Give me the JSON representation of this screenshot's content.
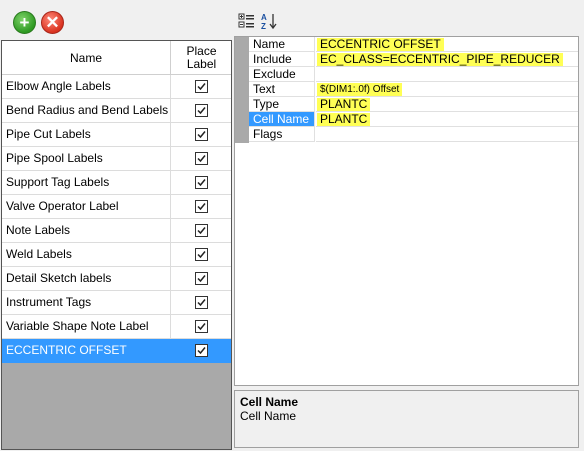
{
  "list": {
    "header_name": "Name",
    "header_place": "Place Label",
    "items": [
      {
        "name": "Elbow Angle Labels",
        "checked": true
      },
      {
        "name": "Bend Radius and Bend Labels",
        "checked": true
      },
      {
        "name": "Pipe Cut Labels",
        "checked": true
      },
      {
        "name": "Pipe Spool Labels",
        "checked": true
      },
      {
        "name": "Support Tag Labels",
        "checked": true
      },
      {
        "name": "Valve Operator Label",
        "checked": true
      },
      {
        "name": "Note Labels",
        "checked": true
      },
      {
        "name": "Weld Labels",
        "checked": true
      },
      {
        "name": "Detail Sketch labels",
        "checked": true
      },
      {
        "name": "Instrument Tags",
        "checked": true
      },
      {
        "name": "Variable Shape Note Label",
        "checked": true
      },
      {
        "name": "ECCENTRIC OFFSET",
        "checked": true,
        "selected": true
      }
    ]
  },
  "toolbar": {
    "add_icon": "add-green-circle-icon",
    "delete_icon": "delete-red-circle-icon",
    "categorized_icon": "categorized-view-icon",
    "sort_az_icon": "sort-alphabetical-icon"
  },
  "properties": [
    {
      "name": "Name",
      "value": "ECCENTRIC OFFSET"
    },
    {
      "name": "Include",
      "value": "EC_CLASS=ECCENTRIC_PIPE_REDUCER"
    },
    {
      "name": "Exclude",
      "value": ""
    },
    {
      "name": "Text",
      "value": "$(DIM1:.0f) Offset"
    },
    {
      "name": "Type",
      "value": "PLANTC"
    },
    {
      "name": "Cell Name",
      "value": "PLANTC",
      "selected": true
    },
    {
      "name": "Flags",
      "value": ""
    }
  ],
  "help": {
    "title": "Cell Name",
    "description": "Cell Name"
  },
  "colors": {
    "selection": "#3399ff",
    "highlight": "#ffff55",
    "panel_gray": "#a9a9a9"
  }
}
